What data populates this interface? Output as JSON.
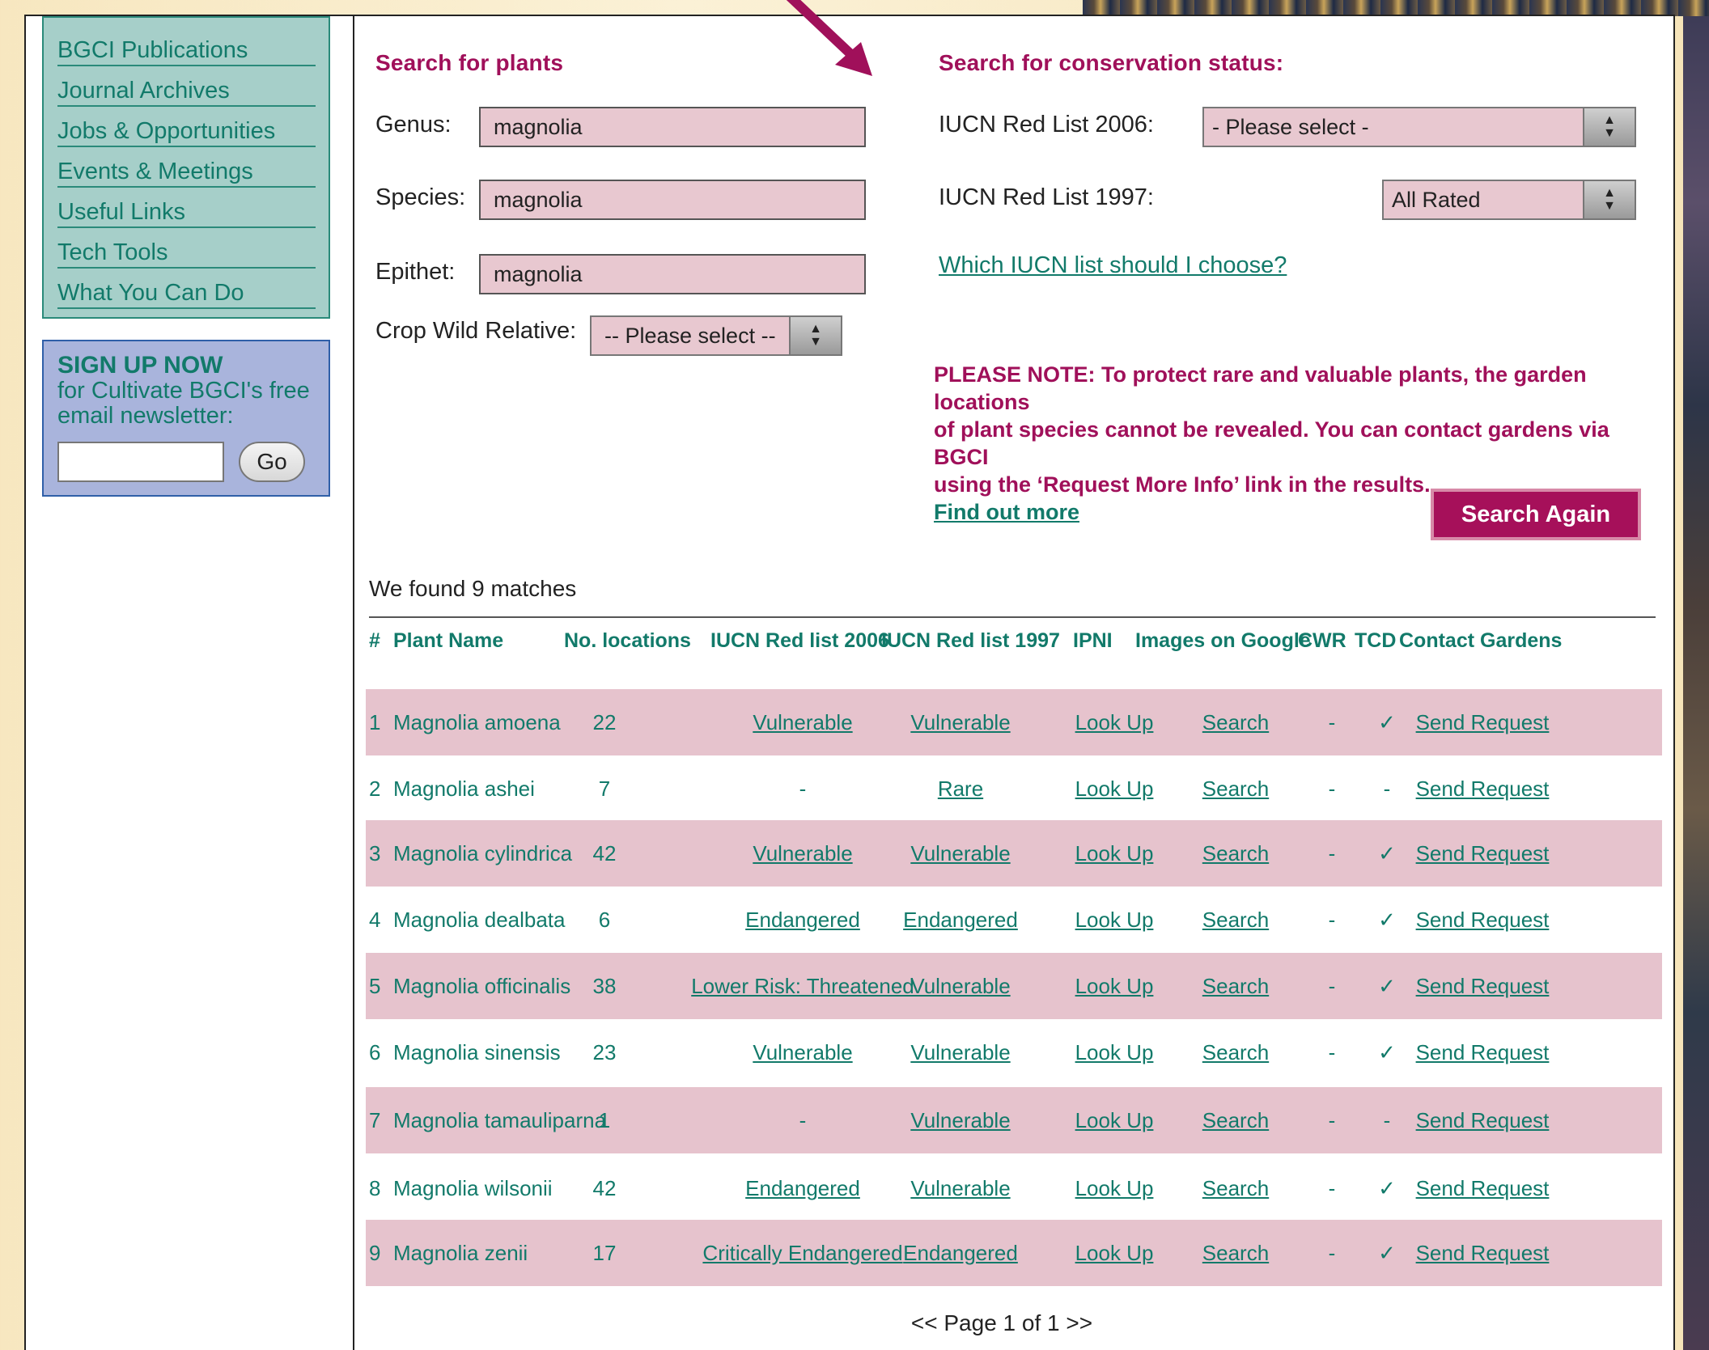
{
  "sidebar": {
    "nav": [
      "BGCI Publications",
      "Journal Archives",
      "Jobs & Opportunities",
      "Events & Meetings",
      "Useful Links",
      "Tech Tools",
      "What You Can Do"
    ],
    "signup_title": "SIGN UP NOW",
    "signup_line1": "for Cultivate BGCI's free",
    "signup_line2": "email newsletter:",
    "go_label": "Go"
  },
  "search_plants": {
    "title": "Search for plants",
    "genus_label": "Genus:",
    "genus_value": "magnolia",
    "species_label": "Species:",
    "species_value": "magnolia",
    "epithet_label": "Epithet:",
    "epithet_value": "magnolia",
    "crop_label": "Crop Wild Relative:",
    "crop_value": "-- Please select --"
  },
  "search_status": {
    "title": "Search for conservation status:",
    "iucn2006_label": "IUCN Red List 2006:",
    "iucn2006_value": "- Please select -",
    "iucn1997_label": "IUCN Red List 1997:",
    "iucn1997_value": "All Rated",
    "help_link": "Which IUCN list should I choose?"
  },
  "note": {
    "line1": "PLEASE NOTE: To protect rare and valuable plants, the garden locations",
    "line2": "of plant species cannot be revealed. You can contact gardens via BGCI",
    "line3": "using the ‘Request More Info’ link in the results.",
    "link": "Find out more"
  },
  "search_again_label": "Search Again",
  "results": {
    "found_text": "We found 9 matches",
    "headers": {
      "num": "#",
      "name": "Plant Name",
      "locations": "No. locations",
      "iucn2006": "IUCN Red list 2006",
      "iucn1997": "IUCN Red list 1997",
      "ipni": "IPNI",
      "images": "Images on Google",
      "cwr": "CWR",
      "tcd": "TCD",
      "contact": "Contact Gardens"
    },
    "rows": [
      {
        "num": "1",
        "name": "Magnolia amoena",
        "locations": "22",
        "iucn2006": "Vulnerable",
        "iucn1997": "Vulnerable",
        "ipni": "Look Up",
        "images": "Search",
        "cwr": "-",
        "tcd": "✓",
        "contact": "Send Request"
      },
      {
        "num": "2",
        "name": "Magnolia ashei",
        "locations": "7",
        "iucn2006": "-",
        "iucn1997": "Rare",
        "ipni": "Look Up",
        "images": "Search",
        "cwr": "-",
        "tcd": "-",
        "contact": "Send Request"
      },
      {
        "num": "3",
        "name": "Magnolia cylindrica",
        "locations": "42",
        "iucn2006": "Vulnerable",
        "iucn1997": "Vulnerable",
        "ipni": "Look Up",
        "images": "Search",
        "cwr": "-",
        "tcd": "✓",
        "contact": "Send Request"
      },
      {
        "num": "4",
        "name": "Magnolia dealbata",
        "locations": "6",
        "iucn2006": "Endangered",
        "iucn1997": "Endangered",
        "ipni": "Look Up",
        "images": "Search",
        "cwr": "-",
        "tcd": "✓",
        "contact": "Send Request"
      },
      {
        "num": "5",
        "name": "Magnolia officinalis",
        "locations": "38",
        "iucn2006": "Lower Risk: Threatened",
        "iucn1997": "Vulnerable",
        "ipni": "Look Up",
        "images": "Search",
        "cwr": "-",
        "tcd": "✓",
        "contact": "Send Request"
      },
      {
        "num": "6",
        "name": "Magnolia sinensis",
        "locations": "23",
        "iucn2006": "Vulnerable",
        "iucn1997": "Vulnerable",
        "ipni": "Look Up",
        "images": "Search",
        "cwr": "-",
        "tcd": "✓",
        "contact": "Send Request"
      },
      {
        "num": "7",
        "name": "Magnolia tamauliparna",
        "locations": "1",
        "iucn2006": "-",
        "iucn1997": "Vulnerable",
        "ipni": "Look Up",
        "images": "Search",
        "cwr": "-",
        "tcd": "-",
        "contact": "Send Request"
      },
      {
        "num": "8",
        "name": "Magnolia wilsonii",
        "locations": "42",
        "iucn2006": "Endangered",
        "iucn1997": "Vulnerable",
        "ipni": "Look Up",
        "images": "Search",
        "cwr": "-",
        "tcd": "✓",
        "contact": "Send Request"
      },
      {
        "num": "9",
        "name": "Magnolia zenii",
        "locations": "17",
        "iucn2006": "Critically Endangered",
        "iucn1997": "Endangered",
        "ipni": "Look Up",
        "images": "Search",
        "cwr": "-",
        "tcd": "✓",
        "contact": "Send Request"
      }
    ],
    "pager": "<< Page 1 of 1 >>"
  },
  "colors": {
    "accent_magenta": "#a0105a",
    "link_teal": "#127a6a",
    "row_pink": "#e6c3cd",
    "nav_bg": "#a6cfc9",
    "signup_bg": "#a9b4dc"
  }
}
